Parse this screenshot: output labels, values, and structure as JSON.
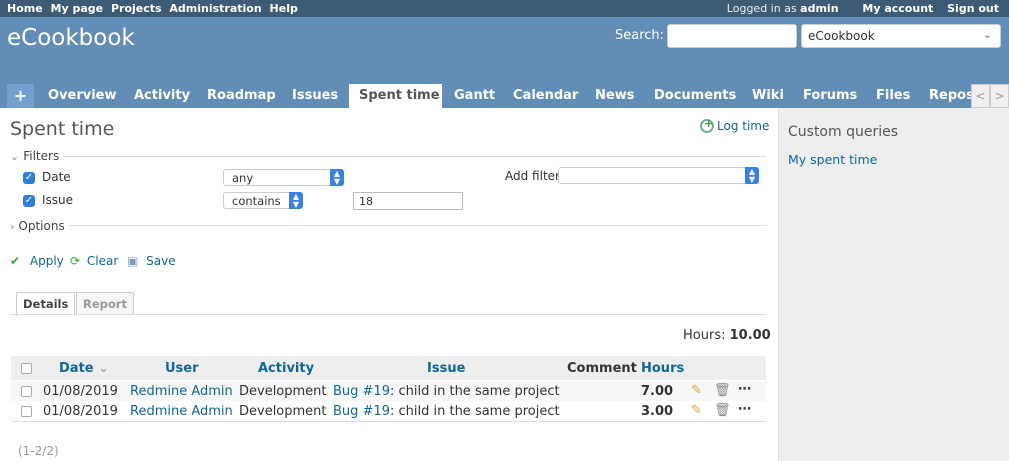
{
  "top_menu": {
    "left": [
      "Home",
      "My page",
      "Projects",
      "Administration",
      "Help"
    ],
    "logged_as_prefix": "Logged in as",
    "logged_as_user": "admin",
    "my_account": "My account",
    "sign_out": "Sign out"
  },
  "header": {
    "title": "eCookbook",
    "search_label": "Search:",
    "search_value": "",
    "project_select": "eCookbook"
  },
  "tabs": {
    "plus": "+",
    "items": [
      "Overview",
      "Activity",
      "Roadmap",
      "Issues",
      "Spent time",
      "Gantt",
      "Calendar",
      "News",
      "Documents",
      "Wiki",
      "Forums",
      "Files",
      "Repos"
    ],
    "selected": "Spent time",
    "scroll_left": "<",
    "scroll_right": ">"
  },
  "page": {
    "title": "Spent time",
    "log_time": "Log time"
  },
  "filters": {
    "legend": "Filters",
    "date_label": "Date",
    "date_operator": "any",
    "issue_label": "Issue",
    "issue_operator": "contains",
    "issue_value": "18",
    "add_filter_label": "Add filter",
    "add_filter_value": ""
  },
  "options": {
    "legend": "Options"
  },
  "buttons": {
    "apply": "Apply",
    "clear": "Clear",
    "save": "Save"
  },
  "subtabs": {
    "details": "Details",
    "report": "Report"
  },
  "totals": {
    "label": "Hours:",
    "value": "10.00"
  },
  "table": {
    "headers": {
      "date": "Date",
      "user": "User",
      "activity": "Activity",
      "issue": "Issue",
      "comment": "Comment",
      "hours": "Hours"
    },
    "sort_indicator": "⌄",
    "rows": [
      {
        "date": "01/08/2019",
        "user": "Redmine Admin",
        "activity": "Development",
        "issue_link": "Bug #19",
        "issue_rest": ": child in the same project",
        "comment": "",
        "hours": "7.00"
      },
      {
        "date": "01/08/2019",
        "user": "Redmine Admin",
        "activity": "Development",
        "issue_link": "Bug #19",
        "issue_rest": ": child in the same project",
        "comment": "",
        "hours": "3.00"
      }
    ]
  },
  "pagination": "(1-2/2)",
  "sidebar": {
    "title": "Custom queries",
    "query": "My spent time"
  },
  "colors": {
    "top_menu_bg": "#3e5b76",
    "header_bg": "#628db6",
    "link": "#169",
    "sidebar_bg": "#eeeeee"
  }
}
